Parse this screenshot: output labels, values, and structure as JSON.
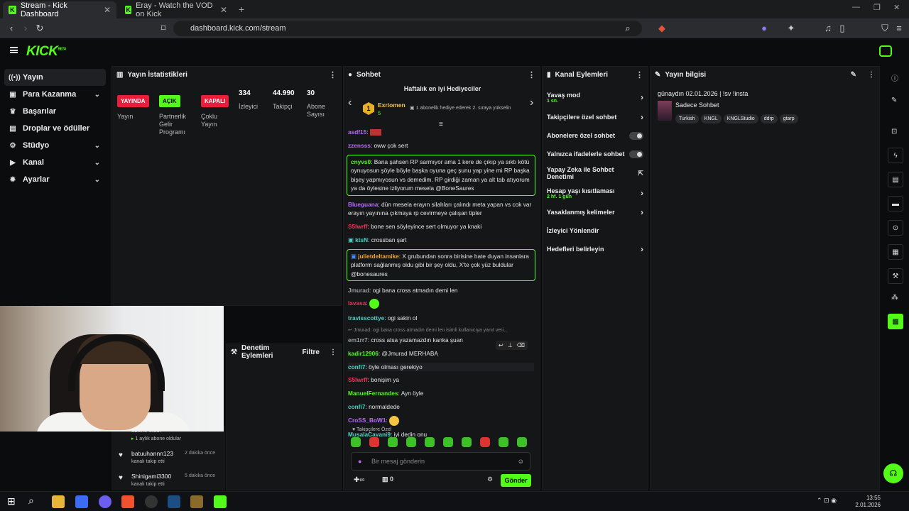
{
  "browser": {
    "tabs": [
      {
        "title": "Stream - Kick Dashboard",
        "active": true
      },
      {
        "title": "Eray - Watch the VOD on Kick",
        "active": false
      }
    ],
    "url": "dashboard.kick.com/stream"
  },
  "brand": {
    "logo": "KICK",
    "beta": "BETA",
    "accent": "#53fc18"
  },
  "sidebar": {
    "items": [
      {
        "label": "Yayın",
        "icon": "broadcast-icon",
        "active": true
      },
      {
        "label": "Para Kazanma",
        "icon": "money-icon",
        "chevron": true
      },
      {
        "label": "Başarılar",
        "icon": "trophy-icon"
      },
      {
        "label": "Droplar ve ödüller",
        "icon": "gift-icon"
      },
      {
        "label": "Stüdyo",
        "icon": "studio-icon",
        "chevron": true
      },
      {
        "label": "Kanal",
        "icon": "channel-icon",
        "chevron": true
      },
      {
        "label": "Ayarlar",
        "icon": "gear-icon",
        "chevron": true
      }
    ]
  },
  "stats": {
    "title": "Yayın İstatistikleri",
    "badges": [
      {
        "badge": "YAYINDA",
        "label": "Yayın",
        "color": "#e91e3a"
      },
      {
        "badge": "AÇIK",
        "label": "Partnerlik Gelir Programı",
        "color": "#53fc18"
      },
      {
        "badge": "KAPALI",
        "label": "Çoklu Yayın",
        "color": "#e91e3a"
      }
    ],
    "numbers": [
      {
        "value": "334",
        "label": "İzleyici"
      },
      {
        "value": "44.990",
        "label": "Takipçi"
      },
      {
        "value": "30",
        "label": "Abone Sayısı"
      }
    ]
  },
  "moderation": {
    "title": "Denetim Eylemleri",
    "filter": "Filtre"
  },
  "activity": {
    "items": [
      {
        "name": "abone oldu.",
        "detail": "1 aylık abone oldular",
        "time": ""
      },
      {
        "name": "batuuhannn123",
        "detail": "kanalı takip etti",
        "time": "2 dakika önce"
      },
      {
        "name": "Shinigami3300",
        "detail": "kanalı takip etti",
        "time": "5 dakika önce"
      }
    ]
  },
  "chat": {
    "title": "Sohbet",
    "top_gifters_title": "Haftalık en iyi Hediyeciler",
    "top_gifter": {
      "rank": "1",
      "name": "Exriomen",
      "count": "5"
    },
    "gift_hint": "1 abonelik hediye ederek 2. sıraya yükselin",
    "messages": [
      {
        "user": "asdf15",
        "text": "",
        "color": "#b86cf5"
      },
      {
        "user": "zzensss",
        "text": "oww çok sert",
        "color": "#b86cf5"
      },
      {
        "user": "cnyvs0",
        "text": "Bana şahsen RP sarmıyor ama 1 kere de çıkıp ya sıktı kötü oynuyosun şöyle böyle başka oyuna geç şunu yap yine mi RP başka bişey yapmıyosun vs demedim. RP girdiği zaman ya alt tab atıyorum ya da öylesine izliyorum mesela @BoneSaures",
        "color": "#53fc18",
        "highlight": true
      },
      {
        "user": "Blueguana",
        "text": "dün mesela erayın silahları çalındı meta yapan vs cok var erayın yayınına çıkmaya rp cevirmeye çalışan tipler",
        "color": "#b86cf5"
      },
      {
        "user": "S5lwrff",
        "text": "bone sen söyleyince sert olmuyor ya knaki",
        "color": "#e9375a"
      },
      {
        "user": "ktsN",
        "text": "crossban şart",
        "color": "#4fd1c5"
      },
      {
        "user": "julietdeltamike",
        "text": "X grubundan sonra birisine hate duyan insanlara platform sağlanmış oldu gibi bir şey oldu, X'te çok yüz buldular @bonesaures",
        "color": "#f5a623",
        "highlight": true
      },
      {
        "user": "Jmurad",
        "text": "ogi bana cross atmadın demi len",
        "color": "#9aa0a6"
      },
      {
        "user": "lavasa",
        "text": "",
        "color": "#e9375a"
      },
      {
        "user": "travisscottye",
        "text": "ogi sakin ol",
        "color": "#4fd1c5"
      },
      {
        "user": "em1rr7",
        "text": "cross atsa yazamazdın kanka şuan",
        "color": "#9aa0a6",
        "reply": "Jmurad: ogi bana cross atmadın demi len isimli kullanıcıya yanıt veri..."
      },
      {
        "user": "kadir12906",
        "text": "@Jmurad MERHABA",
        "color": "#53fc18"
      },
      {
        "user": "confi7",
        "text": "öyle olması gerekiyo",
        "color": "#4fd1c5"
      },
      {
        "user": "S5lwrff",
        "text": "bonişim ya",
        "color": "#e9375a"
      },
      {
        "user": "ManuelFernandes",
        "text": "Ayn öyle",
        "color": "#53fc18"
      },
      {
        "user": "confi7",
        "text": "normaldede",
        "color": "#4fd1c5"
      },
      {
        "user": "CroSS_BoW1",
        "text": "",
        "color": "#b86cf5"
      },
      {
        "user": "MusalaCavani9",
        "text": "iyi dedin onu",
        "color": "#4fd1c5"
      }
    ],
    "followers_only": "Takipçilere Özel",
    "input_placeholder": "Bir mesaj gönderin",
    "send_label": "Gönder",
    "points": "0"
  },
  "channel_actions": {
    "title": "Kanal Eylemleri",
    "items": [
      {
        "label": "Yavaş mod",
        "sub": "1 sn.",
        "type": "arrow"
      },
      {
        "label": "Takipçilere özel sohbet",
        "type": "arrow"
      },
      {
        "label": "Abonelere özel sohbet",
        "type": "toggle"
      },
      {
        "label": "Yalnızca ifadelerle sohbet",
        "type": "toggle"
      },
      {
        "label": "Yapay Zeka ile Sohbet Denetimi",
        "type": "external"
      },
      {
        "label": "Hesap yaşı kısıtlaması",
        "sub": "2 hf. 1 gün",
        "type": "arrow"
      },
      {
        "label": "Yasaklanmış kelimeler",
        "type": "arrow"
      },
      {
        "label": "İzleyici Yönlendir",
        "type": "none"
      },
      {
        "label": "Hedefleri belirleyin",
        "type": "arrow"
      }
    ]
  },
  "stream_info": {
    "title": "Yayın bilgisi",
    "stream_title": "günaydın 02.01.2026 | !sv !insta",
    "category": "Sadece Sohbet",
    "tags": [
      "Turkish",
      "KNGL",
      "KNGLStudio",
      "ddrp",
      "gtarp"
    ]
  },
  "taskbar": {
    "time": "13:55",
    "date": "2.01.2026"
  }
}
